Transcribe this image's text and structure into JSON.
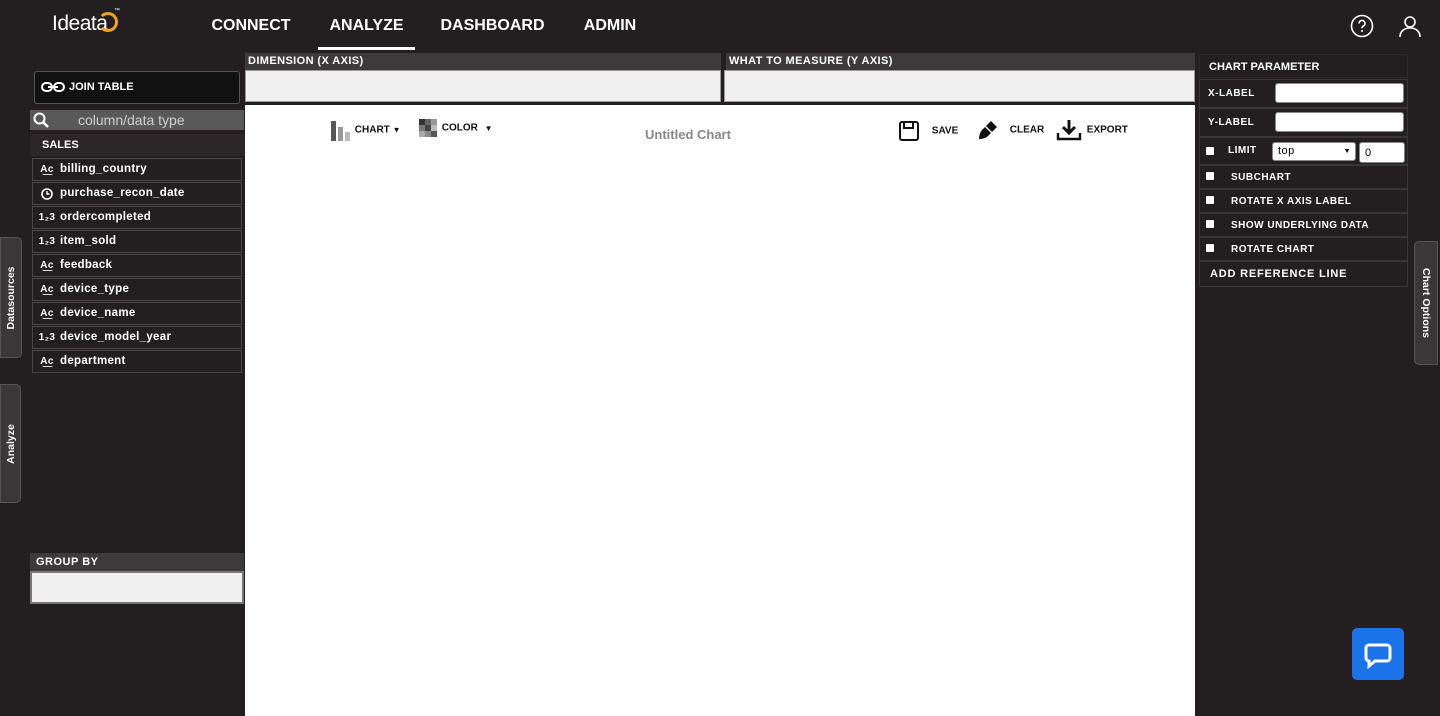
{
  "brand": {
    "name": "Ideata",
    "tm": "™"
  },
  "nav": {
    "connect": "CONNECT",
    "analyze": "ANALYZE",
    "dashboard": "DASHBOARD",
    "admin": "ADMIN"
  },
  "left": {
    "join_table": "JOIN TABLE",
    "search_placeholder": "column/data type",
    "table_name": "SALES",
    "fields": [
      {
        "name": "billing_country",
        "type": "ABC"
      },
      {
        "name": "purchase_recon_date",
        "type": "clock"
      },
      {
        "name": "ordercompleted",
        "type": "123"
      },
      {
        "name": "item_sold",
        "type": "123"
      },
      {
        "name": "feedback",
        "type": "ABC"
      },
      {
        "name": "device_type",
        "type": "ABC"
      },
      {
        "name": "device_name",
        "type": "ABC"
      },
      {
        "name": "device_model_year",
        "type": "123"
      },
      {
        "name": "department",
        "type": "ABC"
      }
    ],
    "group_by": "GROUP BY",
    "tab_datasources": "Datasources",
    "tab_analyze": "Analyze"
  },
  "axes": {
    "dimension": "DIMENSION (X AXIS)",
    "measure": "WHAT TO MEASURE (Y AXIS)"
  },
  "toolbar": {
    "chart": "CHART",
    "color": "COLOR",
    "title": "Untitled Chart",
    "save": "SAVE",
    "clear": "CLEAR",
    "export": "EXPORT"
  },
  "params": {
    "header": "CHART PARAMETER",
    "x_label": "X-LABEL",
    "y_label": "Y-LABEL",
    "limit": "LIMIT",
    "limit_mode": "top",
    "limit_value": "0",
    "subchart": "SUBCHART",
    "rotate_x": "ROTATE X AXIS LABEL",
    "show_underlying": "SHOW UNDERLYING DATA",
    "rotate_chart": "ROTATE CHART",
    "add_ref": "ADD REFERENCE LINE",
    "tab_chart_options": "Chart Options"
  },
  "colors": {
    "background": "#231f20",
    "accent_logo": "#f3a21b",
    "chat": "#1a73e8"
  }
}
